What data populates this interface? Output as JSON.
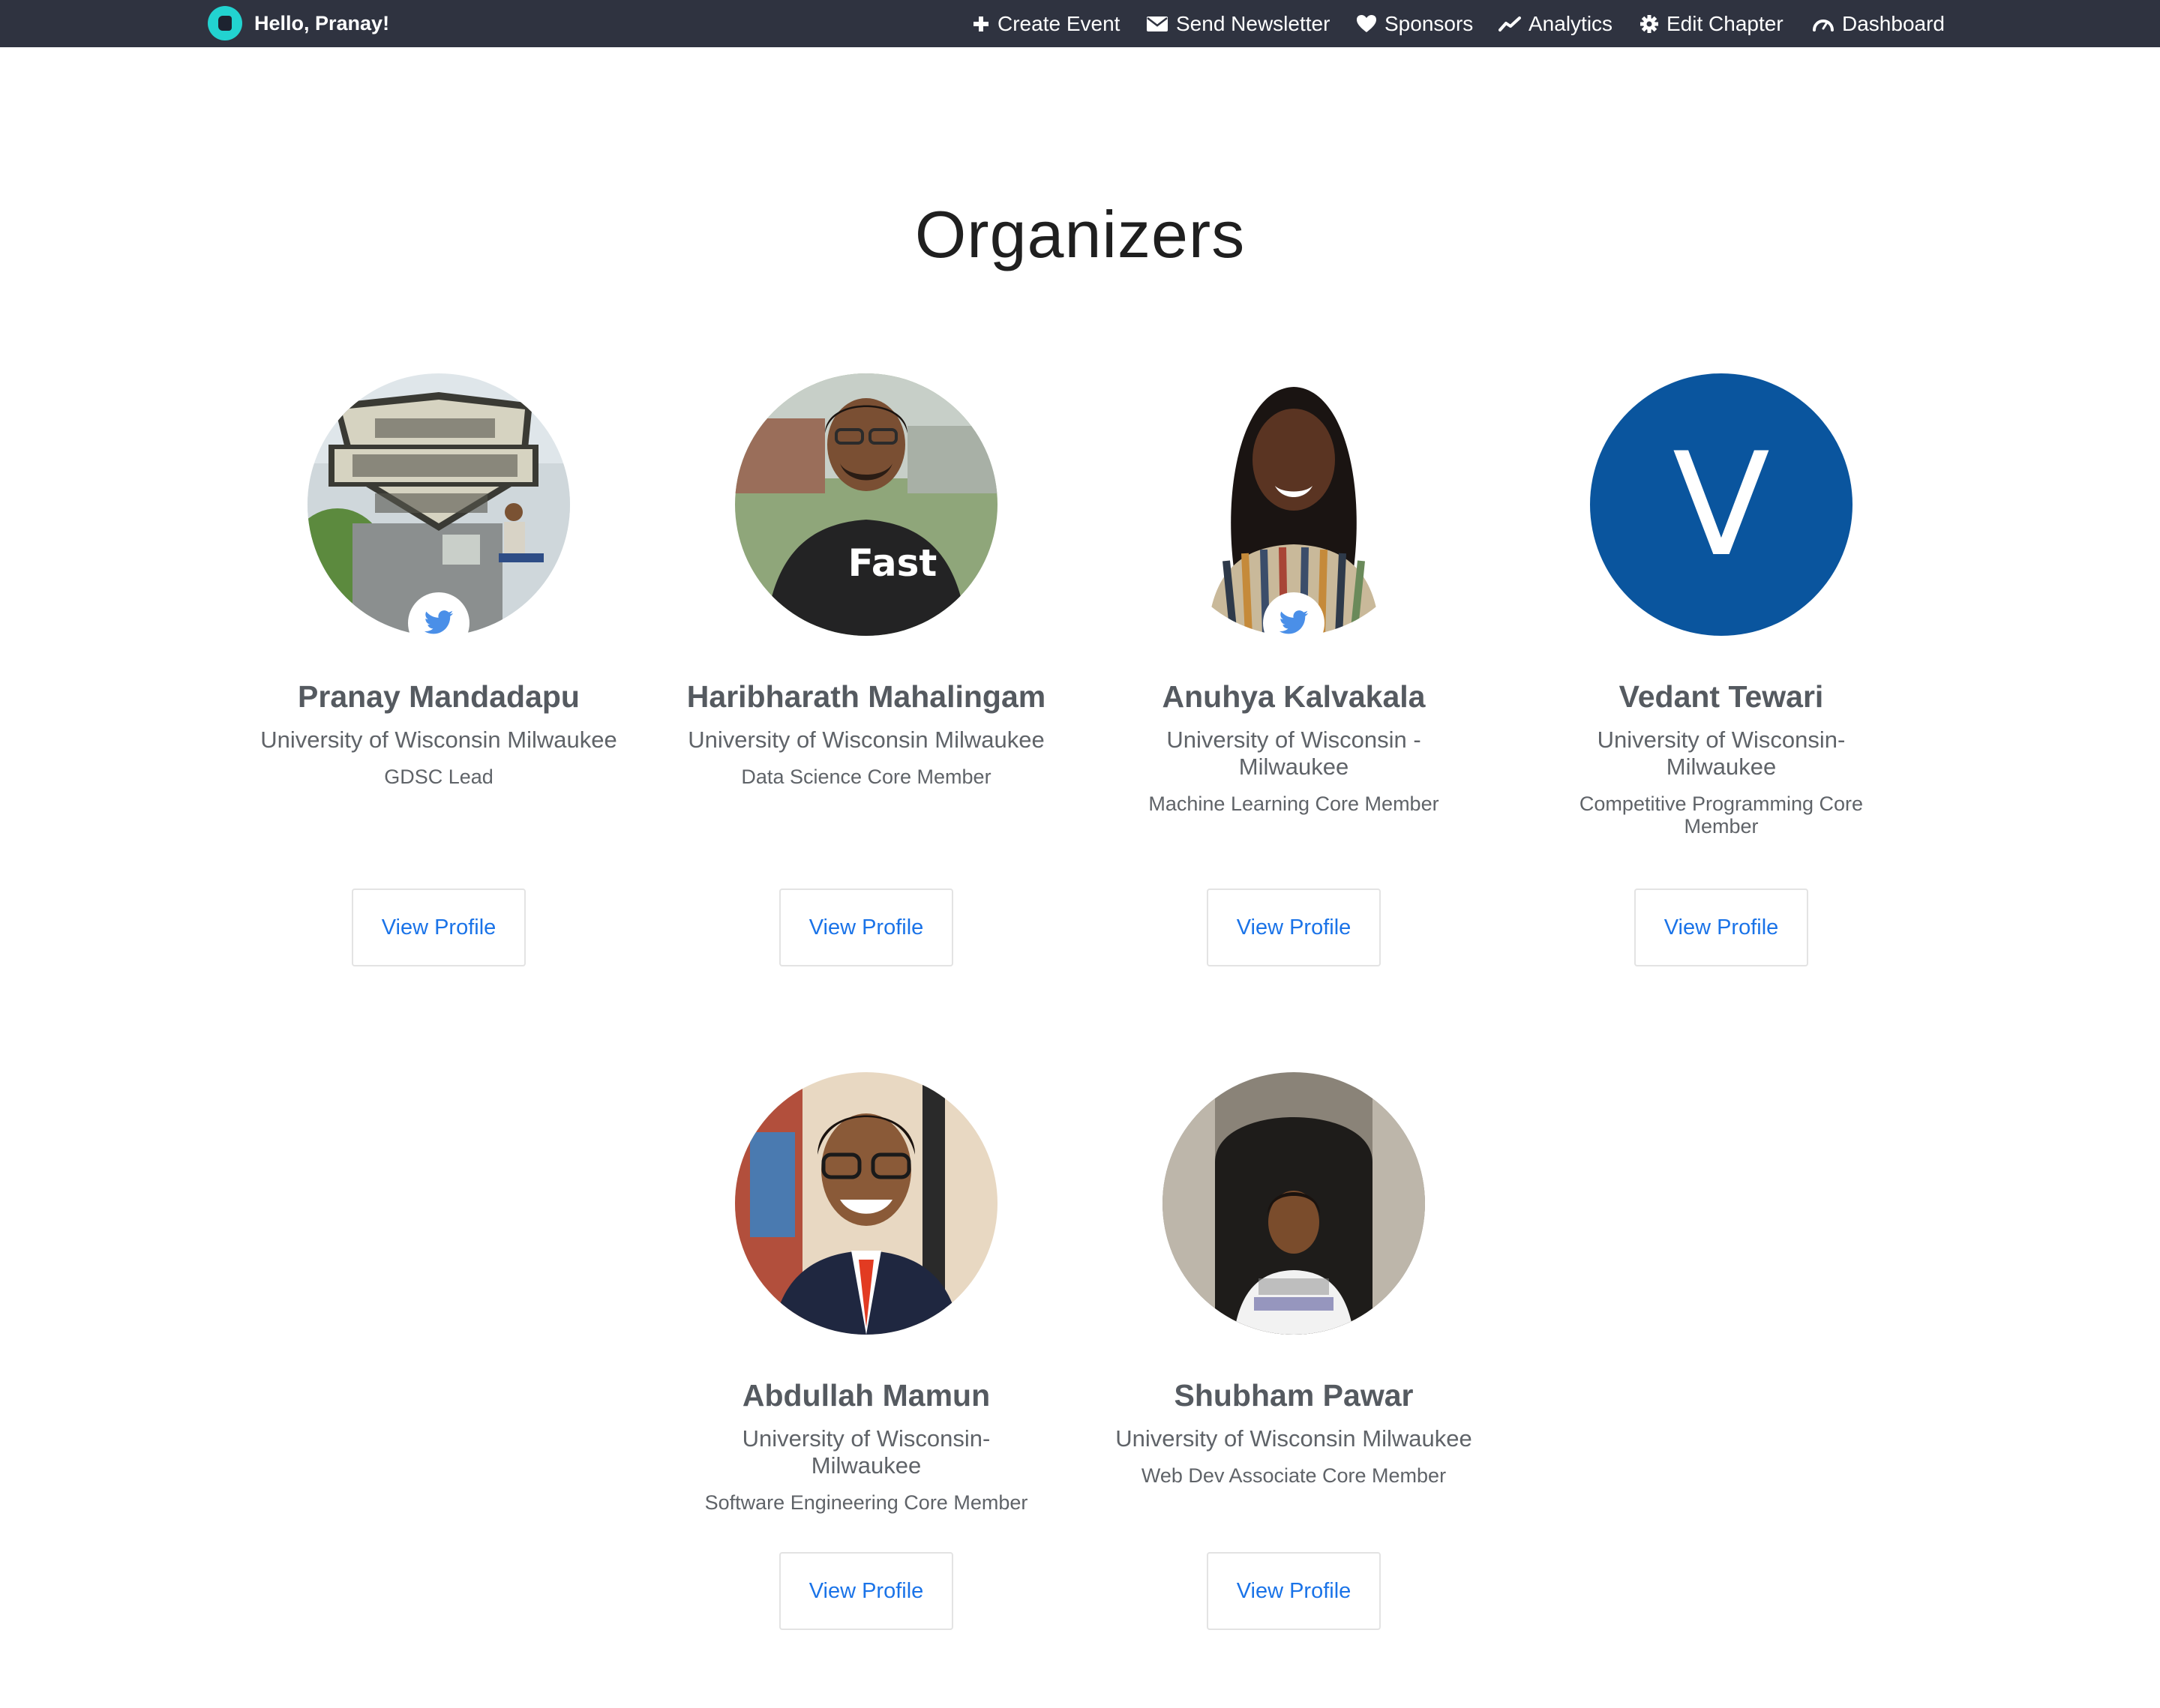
{
  "header": {
    "greeting": "Hello, Pranay!",
    "logo_icon": "community-logo-icon",
    "nav": [
      {
        "label": "Create Event",
        "icon": "plus-icon"
      },
      {
        "label": "Send Newsletter",
        "icon": "envelope-icon"
      },
      {
        "label": "Sponsors",
        "icon": "heart-icon"
      },
      {
        "label": "Analytics",
        "icon": "trend-line-icon"
      },
      {
        "label": "Edit Chapter",
        "icon": "gear-icon"
      },
      {
        "label": "Dashboard",
        "icon": "speedometer-icon"
      }
    ]
  },
  "main": {
    "title": "Organizers",
    "organizers": [
      {
        "name": "Pranay Mandadapu",
        "org": "University of Wisconsin Milwaukee",
        "role": "GDSC Lead",
        "button": "View Profile",
        "twitter": true,
        "avatar": "photo"
      },
      {
        "name": "Haribharath Mahalingam",
        "org": "University of Wisconsin Milwaukee",
        "role": "Data Science Core Member",
        "button": "View Profile",
        "twitter": false,
        "avatar": "photo"
      },
      {
        "name": "Anuhya Kalvakala",
        "org": "University of Wisconsin - Milwaukee",
        "role": "Machine Learning Core Member",
        "button": "View Profile",
        "twitter": true,
        "avatar": "photo"
      },
      {
        "name": "Vedant Tewari",
        "org": "University of Wisconsin- Milwaukee",
        "role": "Competitive Programming Core Member",
        "button": "View Profile",
        "twitter": false,
        "avatar": "letter",
        "letter": "V"
      },
      {
        "name": "Abdullah Mamun",
        "org": "University of Wisconsin- Milwaukee",
        "role": "Software Engineering Core Member",
        "button": "View Profile",
        "twitter": false,
        "avatar": "photo"
      },
      {
        "name": "Shubham Pawar",
        "org": "University of Wisconsin Milwaukee",
        "role": "Web Dev Associate Core Member",
        "button": "View Profile",
        "twitter": false,
        "avatar": "photo"
      }
    ]
  },
  "colors": {
    "topbar": "#2f3340",
    "accent_link": "#1a73e8",
    "logo": "#22d3d0",
    "twitter": "#4a8fe8",
    "letter_avatar": "#0a559e"
  }
}
